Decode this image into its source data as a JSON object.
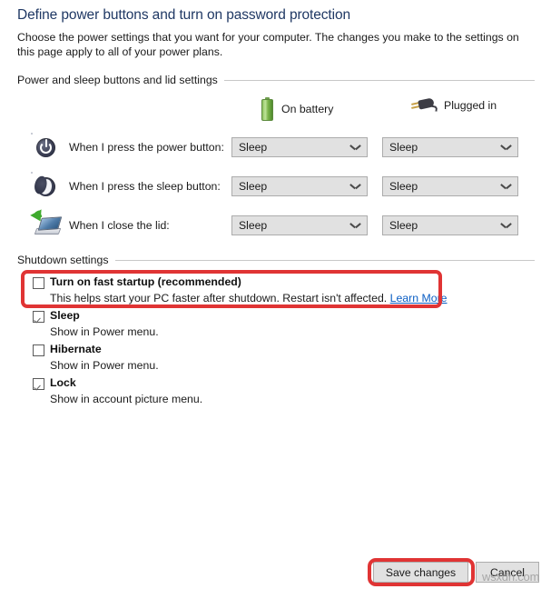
{
  "page": {
    "title": "Define power buttons and turn on password protection",
    "description": "Choose the power settings that you want for your computer. The changes you make to the settings on this page apply to all of your power plans.",
    "title_color": "#1f3864"
  },
  "groups": {
    "power_sleep_lid": "Power and sleep buttons and lid settings",
    "shutdown": "Shutdown settings"
  },
  "columns": {
    "battery": {
      "label": "On battery",
      "icon": "battery-icon"
    },
    "plugged": {
      "label": "Plugged in",
      "icon": "power-plug-icon"
    }
  },
  "rows": [
    {
      "id": "power-button",
      "icon": "power-button-icon",
      "label": "When I press the power button:",
      "on_battery": "Sleep",
      "plugged_in": "Sleep"
    },
    {
      "id": "sleep-button",
      "icon": "sleep-moon-icon",
      "label": "When I press the sleep button:",
      "on_battery": "Sleep",
      "plugged_in": "Sleep"
    },
    {
      "id": "close-lid",
      "icon": "laptop-lid-icon",
      "label": "When I close the lid:",
      "on_battery": "Sleep",
      "plugged_in": "Sleep"
    }
  ],
  "shutdown_options": [
    {
      "id": "fast-startup",
      "label": "Turn on fast startup (recommended)",
      "sublabel": "This helps start your PC faster after shutdown. Restart isn't affected.",
      "link": "Learn More",
      "checked": false,
      "highlighted": true
    },
    {
      "id": "sleep",
      "label": "Sleep",
      "sublabel": "Show in Power menu.",
      "link": "",
      "checked": true,
      "highlighted": false
    },
    {
      "id": "hibernate",
      "label": "Hibernate",
      "sublabel": "Show in Power menu.",
      "link": "",
      "checked": false,
      "highlighted": false
    },
    {
      "id": "lock",
      "label": "Lock",
      "sublabel": "Show in account picture menu.",
      "link": "",
      "checked": true,
      "highlighted": false
    }
  ],
  "footer": {
    "save_label": "Save changes",
    "cancel_label": "Cancel"
  },
  "watermark": "wsxdn.com",
  "annotation_color": "#e03434"
}
